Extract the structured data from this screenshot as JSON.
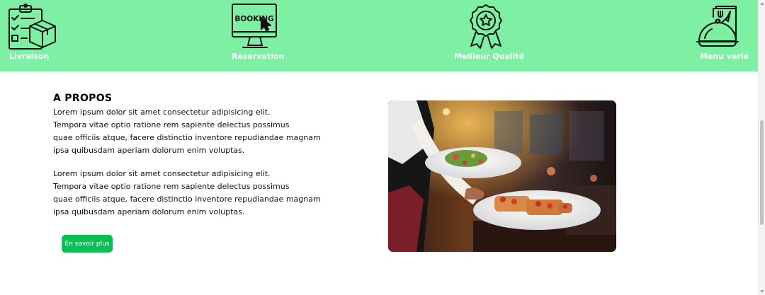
{
  "features": [
    {
      "label": "Livraison",
      "icon": "delivery-checklist-icon"
    },
    {
      "label": "Reservation",
      "icon": "booking-monitor-icon",
      "icon_text": "BOOKING"
    },
    {
      "label": "Meilleur Qualité",
      "icon": "quality-award-badge-icon"
    },
    {
      "label": "Menu varié",
      "icon": "menu-cloche-icon"
    }
  ],
  "about": {
    "title": "A PROPOS",
    "paragraphs": [
      [
        "Lorem ipsum dolor sit amet consectetur adipisicing elit.",
        "Tempora vitae optio ratione rem sapiente delectus possimus",
        "quae officiis atque, facere distinctio inventore repudiandae magnam",
        "ipsa quibusdam aperiam dolorum enim voluptas."
      ],
      [
        "Lorem ipsum dolor sit amet consectetur adipisicing elit.",
        "Tempora vitae optio ratione rem sapiente delectus possimus",
        "quae officiis atque, facere distinctio inventore repudiandae magnam",
        "ipsa quibusdam aperiam dolorum enim voluptas."
      ]
    ],
    "button_label": "En savoir plus",
    "image": "waiter-serving-plates-photo"
  },
  "colors": {
    "banner": "#7ef0a3",
    "button": "#08c153",
    "label_text": "#ffffff"
  }
}
